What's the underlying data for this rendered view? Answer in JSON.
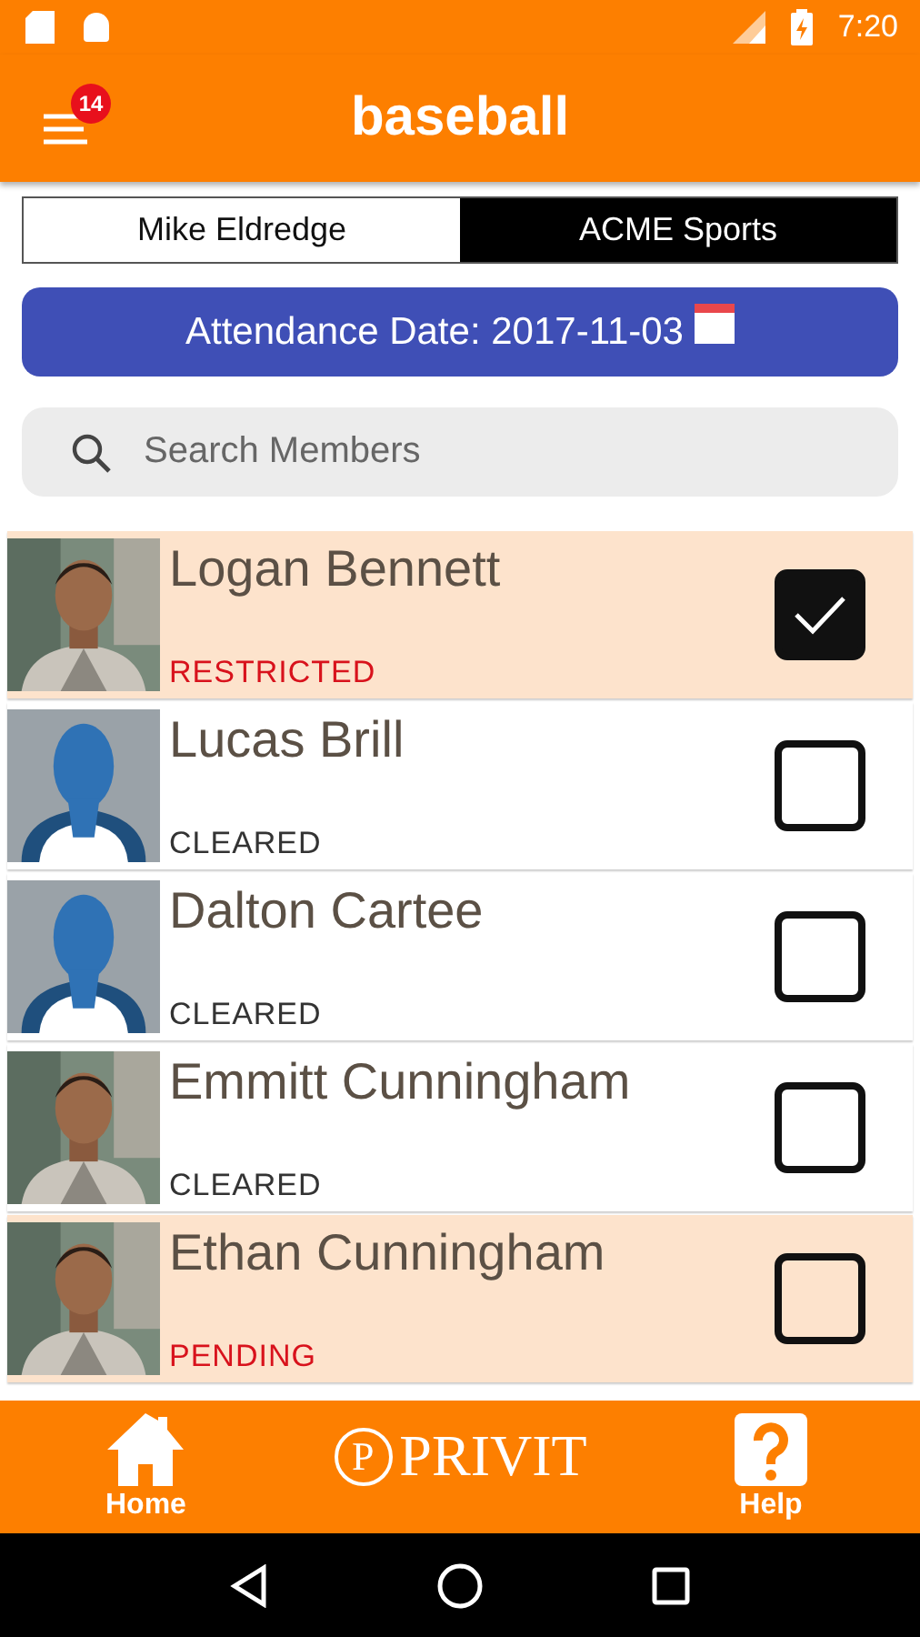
{
  "status_bar": {
    "time": "7:20"
  },
  "app_bar": {
    "title": "baseball",
    "notification_count": "14"
  },
  "tabs": [
    {
      "label": "Mike Eldredge",
      "selected": false
    },
    {
      "label": "ACME Sports",
      "selected": true
    }
  ],
  "date_button": {
    "label": "Attendance Date: 2017-11-03"
  },
  "search": {
    "placeholder": "Search Members"
  },
  "members": [
    {
      "name": "Logan Bennett",
      "status": "RESTRICTED",
      "kind": "restricted",
      "has_photo": true,
      "checked": true
    },
    {
      "name": "Lucas Brill",
      "status": "CLEARED",
      "kind": "cleared",
      "has_photo": false,
      "checked": false
    },
    {
      "name": "Dalton Cartee",
      "status": "CLEARED",
      "kind": "cleared",
      "has_photo": false,
      "checked": false
    },
    {
      "name": "Emmitt Cunningham",
      "status": "CLEARED",
      "kind": "cleared",
      "has_photo": true,
      "checked": false
    },
    {
      "name": "Ethan Cunningham",
      "status": "PENDING",
      "kind": "pending",
      "has_photo": true,
      "checked": false
    }
  ],
  "bottom_bar": {
    "items": [
      {
        "label": "Home",
        "kind": "home"
      },
      {
        "label": "Help",
        "kind": "help"
      }
    ],
    "logo": "PRIVIT",
    "logo_mark": "P"
  }
}
